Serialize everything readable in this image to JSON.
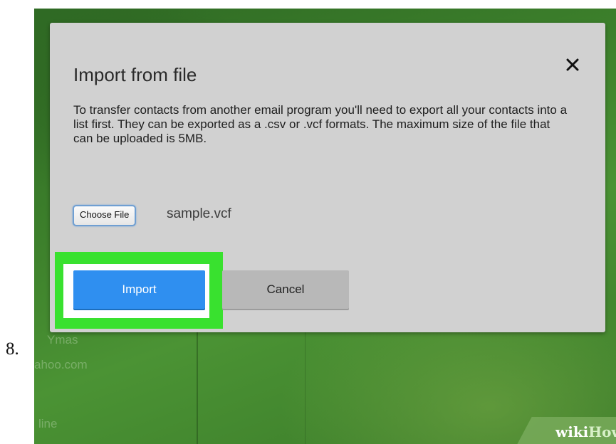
{
  "step": {
    "number": "8."
  },
  "background": {
    "texts": [
      "Ymas",
      "ahoo.com",
      "line"
    ]
  },
  "dialog": {
    "title": "Import from file",
    "close_icon": "close-icon",
    "description": "To transfer contacts from another email program you'll need to export all your contacts into a list first. They can be exported as a .csv or .vcf formats. The maximum size of the file that can be uploaded is 5MB.",
    "file_input": {
      "button_label": "Choose File",
      "selected_file": "sample.vcf"
    },
    "buttons": {
      "import_label": "Import",
      "cancel_label": "Cancel"
    }
  },
  "watermark": {
    "wiki": "wiki",
    "how": "How"
  },
  "colors": {
    "import_button": "#2f8ff0",
    "highlight": "#39e12f",
    "dialog_bg": "#d1d1d1"
  }
}
